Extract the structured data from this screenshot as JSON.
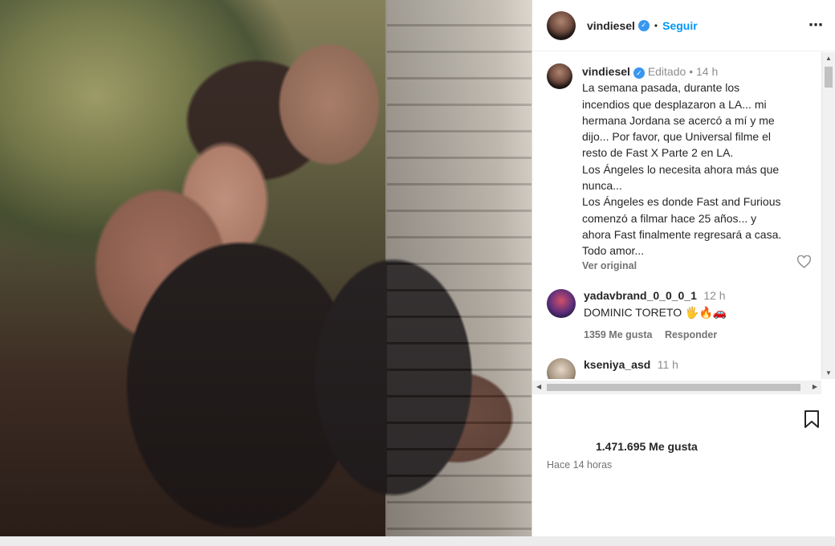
{
  "post": {
    "username": "vindiesel",
    "follow_label": "Seguir",
    "more_icon": "⋯",
    "dot": "•"
  },
  "caption": {
    "username": "vindiesel",
    "edited_label": "Editado",
    "time": "14 h",
    "lines": [
      "La semana pasada, durante los",
      "incendios que desplazaron a LA... mi",
      "hermana Jordana se acercó a mí y me",
      "dijo... Por favor, que Universal filme el",
      "resto de Fast X Parte 2 en LA.",
      "Los Ángeles lo necesita ahora más que",
      "nunca...",
      "Los Ángeles es donde Fast and Furious",
      "comenzó a filmar hace 25 años... y",
      "ahora Fast finalmente regresará a casa.",
      "Todo amor..."
    ],
    "see_original": "Ver original"
  },
  "comments": [
    {
      "username": "yadavbrand_0_0_0_1",
      "time": "12 h",
      "text": "DOMINIC TORETO 🖐🔥🚗",
      "likes": "1359 Me gusta",
      "reply": "Responder"
    },
    {
      "username": "kseniya_asd",
      "time": "11 h"
    }
  ],
  "footer": {
    "likes": "1.471.695 Me gusta",
    "time_ago": "Hace 14 horas"
  },
  "icons": {
    "verified": "verified-badge-icon",
    "heart": "heart-icon",
    "bookmark": "bookmark-icon"
  },
  "colors": {
    "follow": "#0095f6",
    "verified": "#3897f0"
  }
}
